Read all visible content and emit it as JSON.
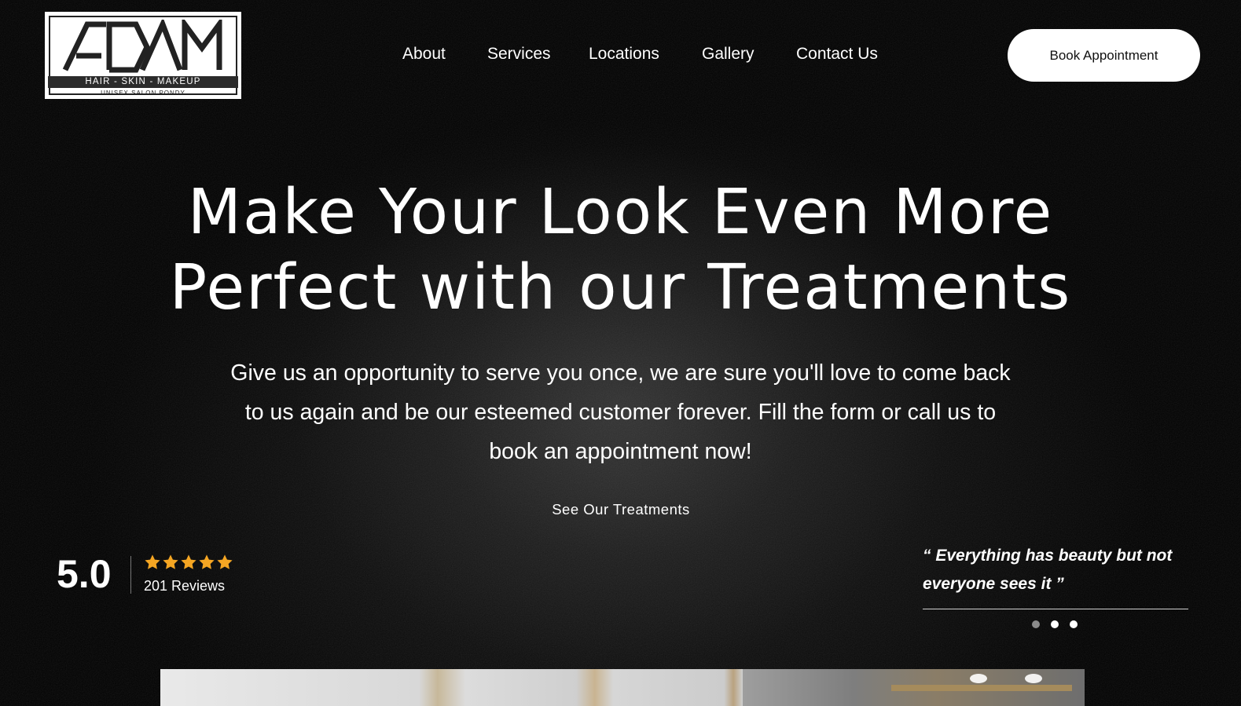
{
  "logo": {
    "wordmark": "ADAM",
    "tagline": "HAIR - SKIN - MAKEUP",
    "subtitle": "UNISEX SALON PONDY"
  },
  "nav": {
    "items": [
      {
        "label": "About"
      },
      {
        "label": "Services"
      },
      {
        "label": "Locations"
      },
      {
        "label": "Gallery"
      },
      {
        "label": "Contact Us"
      }
    ],
    "book_label": "Book Appointment"
  },
  "hero": {
    "title_line1": "Make Your Look Even More",
    "title_line2": "Perfect with our Treatments",
    "text": "Give us an opportunity to serve you once, we are sure you'll love to come back to us again and be our esteemed customer forever. Fill the form or call us to book an appointment now!",
    "cta_label": "See Our Treatments"
  },
  "rating": {
    "score": "5.0",
    "stars": 5,
    "reviews": "201 Reviews",
    "star_color": "#F5A623"
  },
  "quote": {
    "text": "“ Everything has beauty but not everyone sees it ”",
    "slides": 3,
    "active_slide": 2
  },
  "colors": {
    "background": "#000000",
    "text": "#FFFFFF",
    "button_bg": "#FFFFFF",
    "button_text": "#111111"
  }
}
